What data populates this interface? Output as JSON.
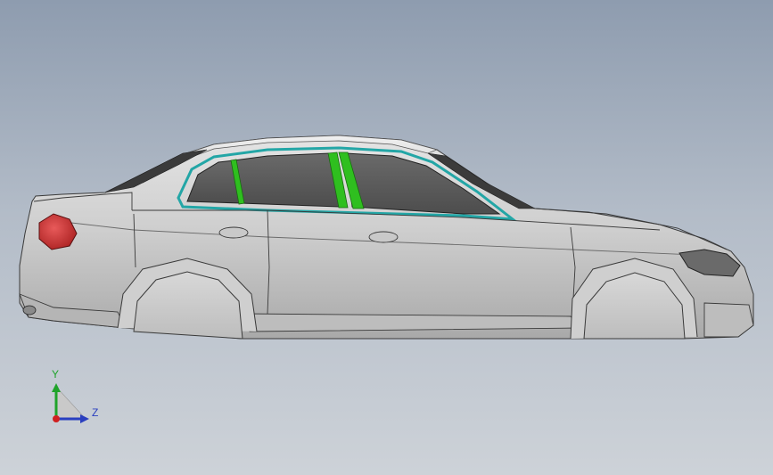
{
  "viewport": {
    "background_top": "#8e9caf",
    "background_bottom": "#cdd2d8"
  },
  "model": {
    "body_color": "#c9c9c9",
    "glass_color": "#5e5e5e",
    "highlight_color": "#2fbf1f",
    "window_trim_color": "#23a6a6",
    "tail_light_color": "#d13030"
  },
  "triad": {
    "y_label": "Y",
    "z_label": "Z",
    "y_color": "#1fa32a",
    "z_color": "#2a3fbf",
    "origin_color": "#d02020"
  }
}
